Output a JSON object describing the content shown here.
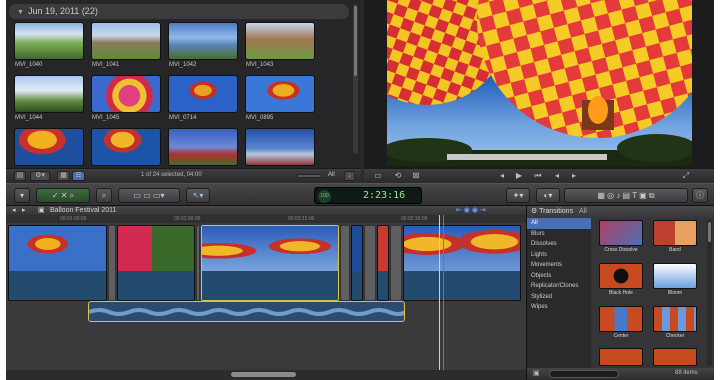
{
  "event_browser": {
    "event_header": "Jun 19, 2011  (22)",
    "clips": [
      {
        "label": "MVI_1040"
      },
      {
        "label": "MVI_1041"
      },
      {
        "label": "MVI_1042"
      },
      {
        "label": "MVI_1043"
      },
      {
        "label": "MVI_1044"
      },
      {
        "label": "MVI_1045"
      },
      {
        "label": "MVI_0714"
      },
      {
        "label": "MVI_0895"
      },
      {
        "label": ""
      },
      {
        "label": ""
      },
      {
        "label": ""
      },
      {
        "label": ""
      }
    ],
    "status": "1 of 24 selected, 04:00",
    "filter": "All"
  },
  "toolbar": {
    "timecode": "2:23:16",
    "percent": "100"
  },
  "timeline": {
    "project_name": "Balloon Festival 2011",
    "ruler": [
      "00:01:00:00",
      "00:02:00:00",
      "00:03:15:00",
      "00:02:30:00"
    ]
  },
  "transitions": {
    "title": "Transitions",
    "filter": "All",
    "categories": [
      "All",
      "Blurs",
      "Dissolves",
      "Lights",
      "Movements",
      "Objects",
      "Replicator/Clones",
      "Stylized",
      "Wipes"
    ],
    "items": [
      {
        "label": "Cross Dissolve"
      },
      {
        "label": "Band"
      },
      {
        "label": "Black Hole"
      },
      {
        "label": "Bloom"
      },
      {
        "label": "Center"
      },
      {
        "label": "Checker"
      }
    ],
    "count": "88 items"
  }
}
